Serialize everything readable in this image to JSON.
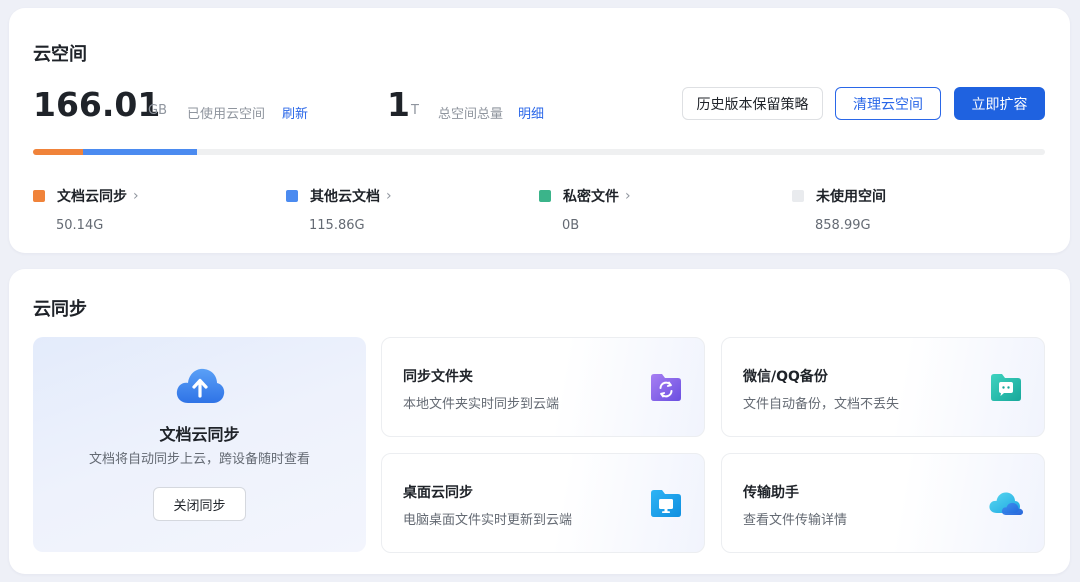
{
  "storage": {
    "title": "云空间",
    "used_value": "166.01",
    "used_unit": "GB",
    "used_hint": "已使用云空间",
    "refresh_label": "刷新",
    "total_value": "1",
    "total_unit": "T",
    "total_hint": "总空间总量",
    "detail_label": "明细",
    "buttons": {
      "history": "历史版本保留策略",
      "clean": "清理云空间",
      "expand": "立即扩容"
    },
    "categories": [
      {
        "label": "文档云同步",
        "value": "50.14G",
        "color": "#f0833a",
        "share": 0.049
      },
      {
        "label": "其他云文档",
        "value": "115.86G",
        "color": "#4b8bf0",
        "share": 0.113
      },
      {
        "label": "私密文件",
        "value": "0B",
        "color": "#3bb48a",
        "share": 0
      },
      {
        "label": "未使用空间",
        "value": "858.99G",
        "color": "#e9ebee",
        "share": 0.838
      }
    ]
  },
  "sync": {
    "title": "云同步",
    "main": {
      "title": "文档云同步",
      "desc": "文档将自动同步上云，跨设备随时查看",
      "button": "关闭同步"
    },
    "tiles": [
      {
        "title": "同步文件夹",
        "desc": "本地文件夹实时同步到云端",
        "icon": "sync-folder-icon"
      },
      {
        "title": "微信/QQ备份",
        "desc": "文件自动备份，文档不丢失",
        "icon": "chat-folder-icon"
      },
      {
        "title": "桌面云同步",
        "desc": "电脑桌面文件实时更新到云端",
        "icon": "desktop-folder-icon"
      },
      {
        "title": "传输助手",
        "desc": "查看文件传输详情",
        "icon": "cloud-icon"
      }
    ]
  }
}
